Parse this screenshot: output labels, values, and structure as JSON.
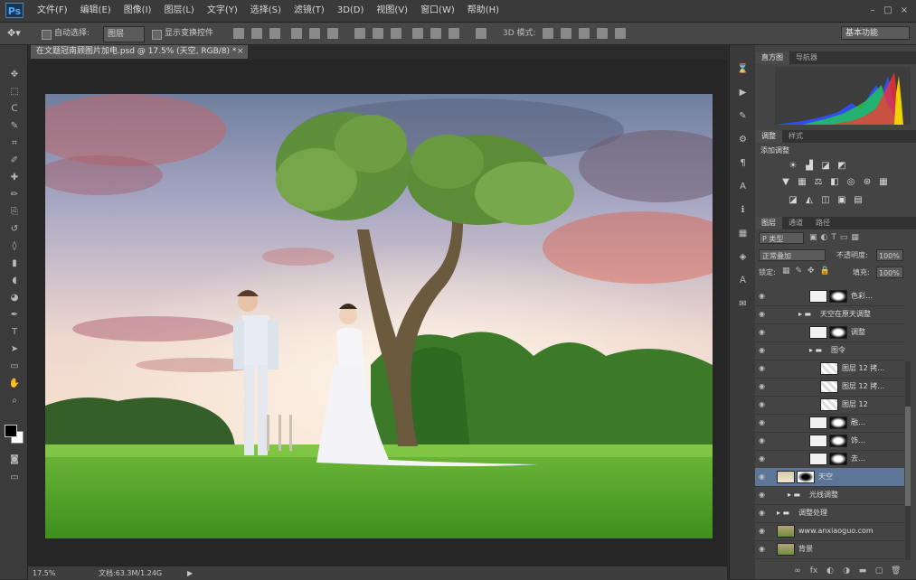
{
  "app": {
    "logo": "Ps"
  },
  "menu": [
    "文件(F)",
    "编辑(E)",
    "图像(I)",
    "图层(L)",
    "文字(Y)",
    "选择(S)",
    "滤镜(T)",
    "3D(D)",
    "视图(V)",
    "窗口(W)",
    "帮助(H)"
  ],
  "window_controls": [
    "minimize-icon",
    "maximize-icon",
    "close-icon"
  ],
  "options_bar": {
    "auto_select_label": "自动选择:",
    "auto_select_value": "图层",
    "show_transform_label": "显示变换控件",
    "workspace_label": "基本功能"
  },
  "document_tab": {
    "title": "在文题冠南顾图片加电.psd @ 17.5% (天空, RGB/8) *",
    "close": "×"
  },
  "status_bar": {
    "zoom": "17.5%",
    "doc_size": "文档:63.3M/1.24G",
    "arrow": "▶"
  },
  "histogram_panel": {
    "tabs": [
      "直方图",
      "导航器"
    ],
    "colors": [
      "#3050ff",
      "#22cc55",
      "#ff3030",
      "#f0d000"
    ]
  },
  "adjustments_panel": {
    "tabs": [
      "调整",
      "样式"
    ],
    "title": "添加调整",
    "icons_row1": [
      "brightness-icon",
      "levels-icon",
      "curves-icon",
      "exposure-icon"
    ],
    "icons_row2": [
      "vibrance-icon",
      "hue-icon",
      "color-balance-icon",
      "bw-icon",
      "photo-filter-icon",
      "channel-mixer-icon",
      "color-lookup-icon"
    ],
    "icons_row3": [
      "invert-icon",
      "posterize-icon",
      "threshold-icon",
      "selective-color-icon",
      "gradient-map-icon"
    ]
  },
  "layers_panel": {
    "tabs": [
      "图层",
      "通道",
      "路径"
    ],
    "filter_label": "P 类型",
    "blend_mode": "正常叠加",
    "opacity_label": "不透明度:",
    "opacity_value": "100%",
    "lock_label": "锁定:",
    "fill_label": "填充:",
    "fill_value": "100%",
    "layers": [
      {
        "name": "色彩…",
        "kind": "adjust",
        "indent": 60
      },
      {
        "name": "天空在原天调整",
        "kind": "group",
        "indent": 48
      },
      {
        "name": "调整",
        "kind": "mask",
        "indent": 60
      },
      {
        "name": "图令",
        "kind": "group",
        "indent": 60
      },
      {
        "name": "图层 12 拷…",
        "kind": "pixel",
        "indent": 72
      },
      {
        "name": "图层 12 拷…",
        "kind": "pixel",
        "indent": 72
      },
      {
        "name": "图层 12",
        "kind": "pixel",
        "indent": 72
      },
      {
        "name": "融…",
        "kind": "mask",
        "indent": 60
      },
      {
        "name": "饰…",
        "kind": "mask",
        "indent": 60
      },
      {
        "name": "去…",
        "kind": "mask",
        "indent": 60
      },
      {
        "name": "天空",
        "kind": "selected",
        "indent": 24
      },
      {
        "name": "光线调整",
        "kind": "group",
        "indent": 36
      },
      {
        "name": "调整处理",
        "kind": "group",
        "indent": 24
      },
      {
        "name": "www.anxiaoguo.com",
        "kind": "photo",
        "indent": 24
      },
      {
        "name": "背景",
        "kind": "photo",
        "indent": 24
      }
    ],
    "footer_icons": [
      "link-icon",
      "fx-icon",
      "mask-icon",
      "adjustment-icon",
      "folder-icon",
      "new-layer-icon",
      "trash-icon"
    ]
  },
  "tools": [
    "move-icon",
    "marquee-icon",
    "lasso-icon",
    "quick-select-icon",
    "crop-icon",
    "eyedropper-icon",
    "heal-icon",
    "brush-icon",
    "stamp-icon",
    "history-brush-icon",
    "eraser-icon",
    "gradient-icon",
    "blur-icon",
    "dodge-icon",
    "pen-icon",
    "type-icon",
    "path-select-icon",
    "shape-icon",
    "hand-icon",
    "zoom-icon"
  ],
  "strip_icons": [
    "history-icon",
    "actions-icon",
    "brush-preset-icon",
    "tool-preset-icon",
    "paragraph-icon",
    "character-icon",
    "info-icon",
    "swatches-icon",
    "3d-icon",
    "text-style-icon",
    "notes-icon"
  ]
}
